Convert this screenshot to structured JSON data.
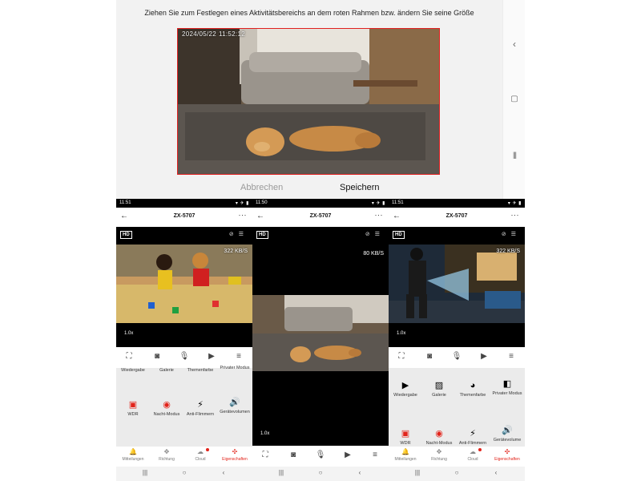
{
  "top_screen": {
    "instruction": "Ziehen Sie zum Festlegen eines Aktivitätsbereichs an dem roten Rahmen bzw. ändern Sie seine Größe",
    "osd_date": "2024/05/22",
    "osd_time": "11:52:12",
    "cancel_label": "Abbrechen",
    "save_label": "Speichern",
    "frame_color": "#e02020"
  },
  "phones": [
    {
      "status_time": "11:51",
      "title": "ZX-5707",
      "hd_label": "HD",
      "speed": "322 KB/S",
      "zoom": "1.0x",
      "grid_row1": [
        "Wiedergabe",
        "Galerie",
        "Themenfarbe",
        "Privater Modus"
      ],
      "grid_row2": [
        "WDR",
        "Nacht-Modus",
        "Anti-Flimmern",
        "Gerätevolumen"
      ],
      "nav": [
        "Mitteilungen",
        "Richtung",
        "Cloud",
        "Eigenschaften"
      ]
    },
    {
      "status_time": "11:50",
      "title": "ZX-5707",
      "hd_label": "HD",
      "speed": "80 KB/S",
      "zoom": "1.0x"
    },
    {
      "status_time": "11:51",
      "title": "ZX-5707",
      "hd_label": "HD",
      "speed": "322 KB/S",
      "zoom": "1.0x",
      "grid_row1": [
        "Wiedergabe",
        "Galerie",
        "Themenfarbe",
        "Privater Modus"
      ],
      "grid_row2": [
        "WDR",
        "Nacht-Modus",
        "Anti-Flimmern",
        "Gerätevolume"
      ],
      "nav": [
        "Mitteilungen",
        "Richtung",
        "Cloud",
        "Eigenschaften"
      ]
    }
  ],
  "icons": {
    "back": "arrow-left-icon",
    "more": "more-icon",
    "accent": "#e2231a"
  }
}
